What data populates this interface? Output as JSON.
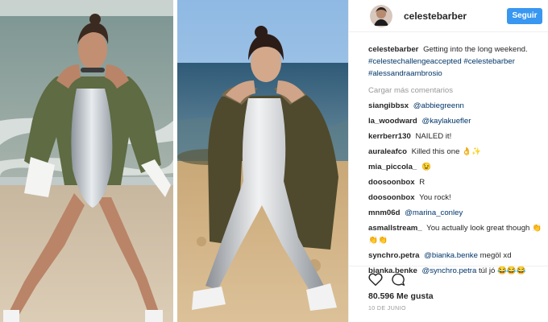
{
  "post": {
    "username": "celestebarber",
    "follow_label": "Seguir",
    "caption": {
      "text": "Getting into the long weekend.",
      "hashtags": [
        "#celestechallengeaccepted",
        "#celestebarber",
        "#alessandraambrosio"
      ]
    },
    "load_more": "Cargar más comentarios",
    "comments": [
      {
        "user": "siangibbsx",
        "mention": "@abbiegreenn",
        "text": ""
      },
      {
        "user": "la_woodward",
        "mention": "@kaylakuefler",
        "text": ""
      },
      {
        "user": "kerrberr130",
        "mention": "",
        "text": "NAILED it!"
      },
      {
        "user": "auraleafco",
        "mention": "",
        "text": "Killed this one 👌✨"
      },
      {
        "user": "mia_piccola_",
        "mention": "",
        "text": "😉"
      },
      {
        "user": "doosoonbox",
        "mention": "",
        "text": "R"
      },
      {
        "user": "doosoonbox",
        "mention": "",
        "text": "You rock!"
      },
      {
        "user": "mnm06d",
        "mention": "@marina_conley",
        "text": ""
      },
      {
        "user": "asmallstream_",
        "mention": "",
        "text": "You actually look great though 👏👏👏"
      },
      {
        "user": "synchro.petra",
        "mention": "@bianka.benke",
        "text": "megöl xd"
      },
      {
        "user": "bianka.benke",
        "mention": "@synchro.petra",
        "text": "túl jó 😂😂😂"
      }
    ],
    "likes": "80.596 Me gusta",
    "date": "10 DE JUNIO"
  },
  "icons": {
    "like": "heart-icon",
    "comment": "comment-icon"
  },
  "colors": {
    "follow_button": "#3897f0",
    "link": "#003569",
    "muted": "#999999"
  }
}
